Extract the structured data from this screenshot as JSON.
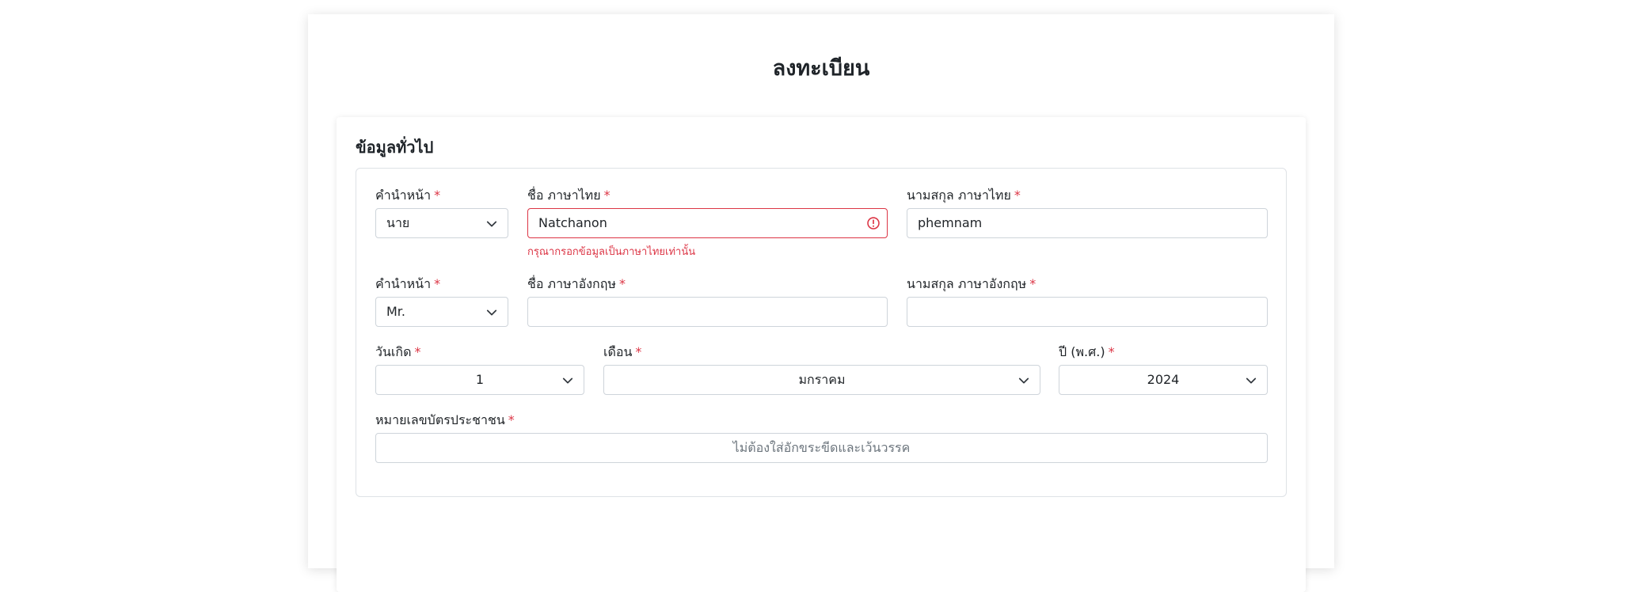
{
  "page": {
    "title": "ลงทะเบียน"
  },
  "section": {
    "title": "ข้อมูลทั่วไป"
  },
  "required_mark": "*",
  "fields": {
    "prefix_th": {
      "label": "คำนำหน้า",
      "value": "นาย"
    },
    "firstname_th": {
      "label": "ชื่อ ภาษาไทย",
      "value": "Natchanon",
      "error": "กรุณากรอกข้อมูลเป็นภาษาไทยเท่านั้น"
    },
    "lastname_th": {
      "label": "นามสกุล ภาษาไทย",
      "value": "phemnam"
    },
    "prefix_en": {
      "label": "คำนำหน้า",
      "value": "Mr."
    },
    "firstname_en": {
      "label": "ชื่อ ภาษาอังกฤษ",
      "value": ""
    },
    "lastname_en": {
      "label": "นามสกุล ภาษาอังกฤษ",
      "value": ""
    },
    "birth_day": {
      "label": "วันเกิด",
      "value": "1"
    },
    "birth_month": {
      "label": "เดือน",
      "value": "มกราคม"
    },
    "birth_year": {
      "label": "ปี (พ.ศ.)",
      "value": "2024"
    },
    "id_card": {
      "label": "หมายเลขบัตรประชาชน",
      "placeholder": "ไม่ต้องใส่อักขระขีดและเว้นวรรค"
    }
  },
  "colors": {
    "required": "#dc3545",
    "error": "#dc3545",
    "border": "#ced4da"
  },
  "icons": {
    "select": "chevron-down-icon",
    "error": "error-circle-icon"
  }
}
